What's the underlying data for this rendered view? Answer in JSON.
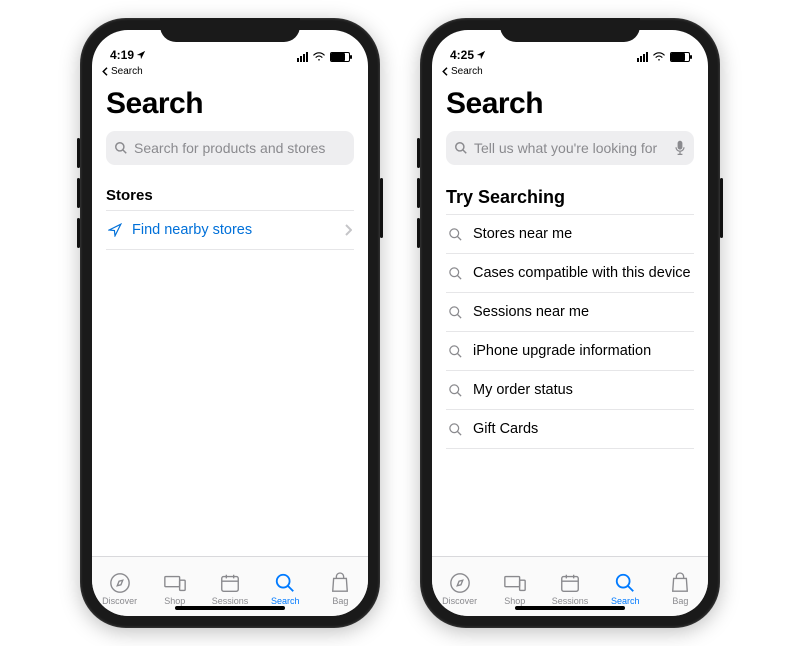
{
  "phones": [
    {
      "status": {
        "time": "4:19",
        "back_label": "Search"
      },
      "title": "Search",
      "search": {
        "placeholder": "Search for products and stores",
        "show_mic": false
      },
      "section_header": "Stores",
      "section_big": false,
      "rows": [
        {
          "icon": "location",
          "label": "Find nearby stores",
          "link": true,
          "chevron": true
        }
      ]
    },
    {
      "status": {
        "time": "4:25",
        "back_label": "Search"
      },
      "title": "Search",
      "search": {
        "placeholder": "Tell us what you're looking for",
        "show_mic": true
      },
      "section_header": "Try Searching",
      "section_big": true,
      "rows": [
        {
          "icon": "search",
          "label": "Stores near me"
        },
        {
          "icon": "search",
          "label": "Cases compatible with this device"
        },
        {
          "icon": "search",
          "label": "Sessions near me"
        },
        {
          "icon": "search",
          "label": "iPhone upgrade information"
        },
        {
          "icon": "search",
          "label": "My order status"
        },
        {
          "icon": "search",
          "label": "Gift Cards"
        }
      ]
    }
  ],
  "tabs": [
    {
      "id": "discover",
      "label": "Discover"
    },
    {
      "id": "shop",
      "label": "Shop"
    },
    {
      "id": "sessions",
      "label": "Sessions"
    },
    {
      "id": "search",
      "label": "Search",
      "active": true
    },
    {
      "id": "bag",
      "label": "Bag"
    }
  ]
}
